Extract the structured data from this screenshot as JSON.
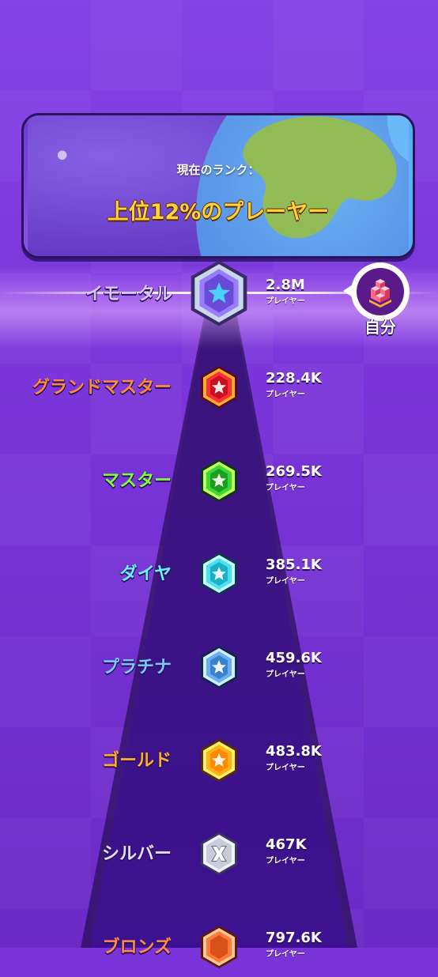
{
  "banner": {
    "subtitle": "現在のランク：",
    "title": "上位12%のプレーヤー"
  },
  "player": {
    "label": "自分"
  },
  "tiers": [
    {
      "name": "イモータル",
      "count": "2.8M",
      "unit": "プレイヤー",
      "name_color": "#d8c8ff",
      "badge_color": "#9a7cff",
      "current": true
    },
    {
      "name": "グランドマスター",
      "count": "228.4K",
      "unit": "プレイヤー",
      "name_color": "#ff8a3a",
      "badge_color": "#ff2f3a"
    },
    {
      "name": "マスター",
      "count": "269.5K",
      "unit": "プレイヤー",
      "name_color": "#7cff3a",
      "badge_color": "#3ad83a"
    },
    {
      "name": "ダイヤ",
      "count": "385.1K",
      "unit": "プレイヤー",
      "name_color": "#6af0ff",
      "badge_color": "#4ae0f0"
    },
    {
      "name": "プラチナ",
      "count": "459.6K",
      "unit": "プレイヤー",
      "name_color": "#7ac8ff",
      "badge_color": "#6ab0f0"
    },
    {
      "name": "ゴールド",
      "count": "483.8K",
      "unit": "プレイヤー",
      "name_color": "#ffb02a",
      "badge_color": "#ffb01a"
    },
    {
      "name": "シルバー",
      "count": "467K",
      "unit": "プレイヤー",
      "name_color": "#e6e0f5",
      "badge_color": "#c8ccd8"
    },
    {
      "name": "ブロンズ",
      "count": "797.6K",
      "unit": "プレイヤー",
      "name_color": "#ff8a4a",
      "badge_color": "#ff7a3a"
    }
  ]
}
